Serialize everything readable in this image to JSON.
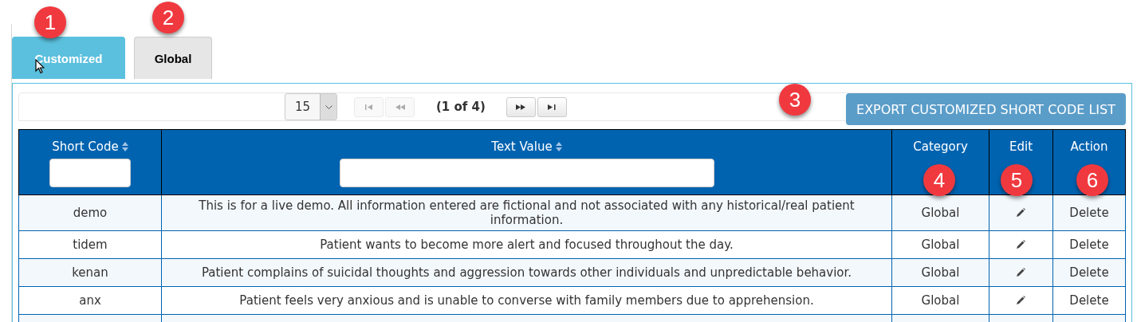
{
  "tabs": [
    {
      "label": "Customized",
      "selected": true
    },
    {
      "label": "Global",
      "selected": false
    }
  ],
  "pager": {
    "page_size": "15",
    "page_info": "(1 of 4)",
    "buttons": [
      {
        "kind": "first",
        "disabled": true
      },
      {
        "kind": "prev",
        "disabled": true
      },
      {
        "kind": "next",
        "disabled": false
      },
      {
        "kind": "last",
        "disabled": false
      }
    ]
  },
  "export_button": "EXPORT CUSTOMIZED SHORT CODE LIST",
  "table": {
    "columns": [
      {
        "label": "Short Code",
        "sortable": true,
        "filter": true
      },
      {
        "label": "Text Value",
        "sortable": true,
        "filter": true
      },
      {
        "label": "Category",
        "sortable": false,
        "filter": false
      },
      {
        "label": "Edit",
        "sortable": false,
        "filter": false
      },
      {
        "label": "Action",
        "sortable": false,
        "filter": false
      }
    ],
    "rows": [
      {
        "short_code": "demo",
        "text_value": "This is for a live demo. All information entered are fictional and not associated with any historical/real patient information.",
        "category": "Global",
        "action": "Delete"
      },
      {
        "short_code": "tidem",
        "text_value": "Patient wants to become more alert and focused throughout the day.",
        "category": "Global",
        "action": "Delete"
      },
      {
        "short_code": "kenan",
        "text_value": "Patient complains of suicidal thoughts and aggression towards other individuals and unpredictable behavior.",
        "category": "Global",
        "action": "Delete"
      },
      {
        "short_code": "anx",
        "text_value": "Patient feels very anxious and is unable to converse with family members due to apprehension.",
        "category": "Global",
        "action": "Delete"
      }
    ]
  },
  "callouts": [
    "1",
    "2",
    "3",
    "4",
    "5",
    "6"
  ]
}
